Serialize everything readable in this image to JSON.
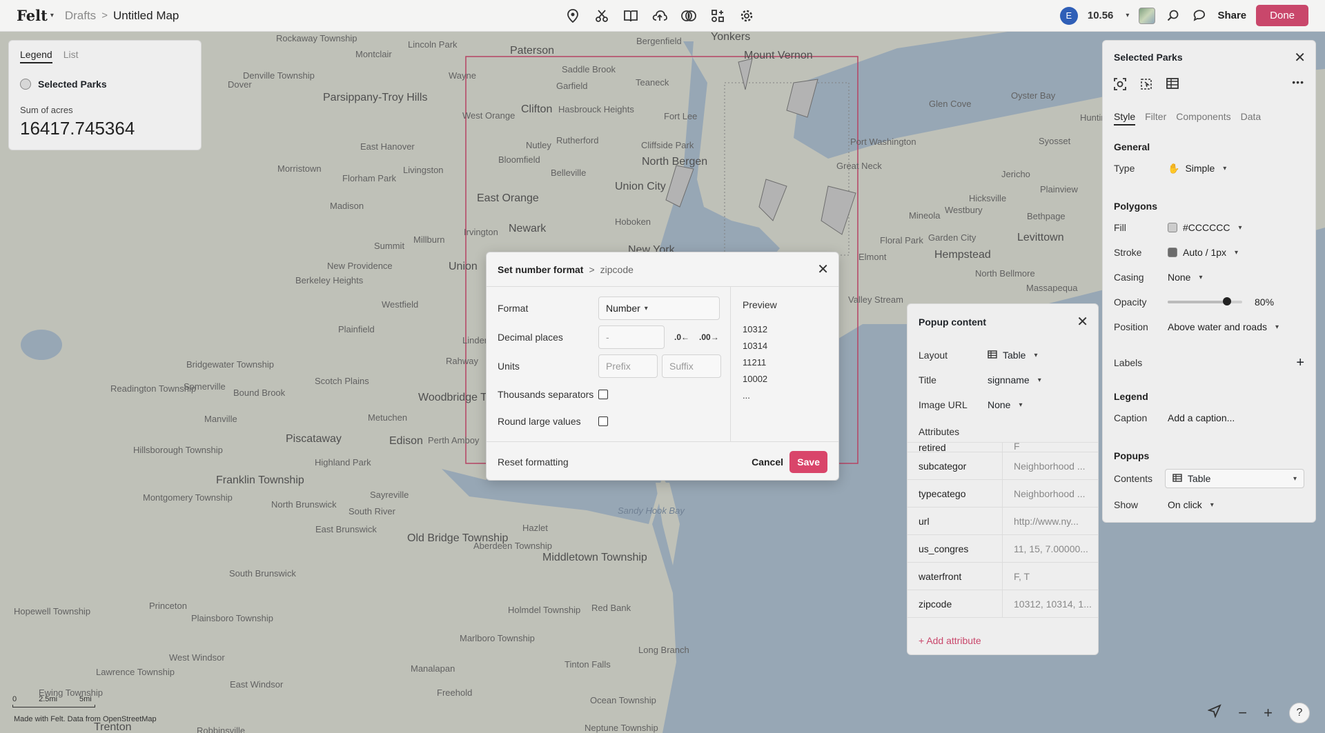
{
  "topbar": {
    "logo": "Felt",
    "breadcrumb_parent": "Drafts",
    "breadcrumb_sep": ">",
    "map_title": "Untitled Map",
    "avatar_initial": "E",
    "zoom_level": "10.56",
    "share_label": "Share",
    "done_label": "Done",
    "tools": [
      "pin-icon",
      "scissors-icon",
      "book-icon",
      "upload-icon",
      "blend-icon",
      "elements-icon",
      "gear-icon"
    ]
  },
  "legend": {
    "tabs": [
      "Legend",
      "List"
    ],
    "layer_name": "Selected Parks",
    "stat_label": "Sum of acres",
    "stat_value": "16417.745364"
  },
  "dialog": {
    "title": "Set number format",
    "sep": ">",
    "field": "zipcode",
    "format_label": "Format",
    "format_value": "Number",
    "decimal_label": "Decimal places",
    "decimal_placeholder": "-",
    "units_label": "Units",
    "prefix_placeholder": "Prefix",
    "suffix_placeholder": "Suffix",
    "thousands_label": "Thousands separators",
    "round_label": "Round large values",
    "preview_label": "Preview",
    "preview_values": [
      "10312",
      "10314",
      "11211",
      "10002",
      "..."
    ],
    "reset_label": "Reset formatting",
    "cancel_label": "Cancel",
    "save_label": "Save"
  },
  "popup_panel": {
    "title": "Popup content",
    "layout_label": "Layout",
    "layout_value": "Table",
    "title_label": "Title",
    "title_value": "signname",
    "image_label": "Image URL",
    "image_value": "None",
    "attributes_label": "Attributes",
    "attributes": [
      {
        "key": "retired",
        "value": "F"
      },
      {
        "key": "subcategor",
        "value": "Neighborhood ..."
      },
      {
        "key": "typecatego",
        "value": "Neighborhood ..."
      },
      {
        "key": "url",
        "value": "http://www.ny..."
      },
      {
        "key": "us_congres",
        "value": "11, 15, 7.00000..."
      },
      {
        "key": "waterfront",
        "value": "F, T"
      },
      {
        "key": "zipcode",
        "value": "10312, 10314, 1..."
      }
    ],
    "add_attribute": "Add attribute"
  },
  "right_panel": {
    "title": "Selected Parks",
    "tabs": [
      "Style",
      "Filter",
      "Components",
      "Data"
    ],
    "general_h": "General",
    "type_label": "Type",
    "type_value": "Simple",
    "polygons_h": "Polygons",
    "fill_label": "Fill",
    "fill_value": "#CCCCCC",
    "fill_color": "#CCCCCC",
    "stroke_label": "Stroke",
    "stroke_value": "Auto / 1px",
    "stroke_color": "#6b6b6b",
    "casing_label": "Casing",
    "casing_value": "None",
    "opacity_label": "Opacity",
    "opacity_value": "80%",
    "opacity_fraction": 0.8,
    "position_label": "Position",
    "position_value": "Above water and roads",
    "labels_h": "Labels",
    "legend_h": "Legend",
    "caption_label": "Caption",
    "caption_placeholder": "Add a caption...",
    "popups_h": "Popups",
    "contents_label": "Contents",
    "contents_value": "Table",
    "show_label": "Show",
    "show_value": "On click"
  },
  "map": {
    "labels": [
      "Paterson",
      "Yonkers",
      "Mount Vernon",
      "Bergenfield",
      "Teaneck",
      "Fort Lee",
      "Clifton",
      "Newark",
      "East Orange",
      "Union City",
      "Hoboken",
      "North Bergen",
      "New York",
      "Garden City",
      "Hempstead",
      "Levittown",
      "Edison",
      "Woodbridge Township",
      "Perth Amboy",
      "Franklin Township",
      "Piscataway",
      "Plainfield",
      "Westfield",
      "Union",
      "Old Bridge Township",
      "Middletown Township",
      "Red Bank",
      "Long Branch",
      "Hazlet",
      "Sandy Hook Bay",
      "Princeton",
      "Trenton",
      "Freehold",
      "Ocean Township",
      "Neptune Township",
      "Montclair",
      "Bloomfield",
      "Irvington",
      "Livingston",
      "Morristown",
      "Madison",
      "Summit",
      "Millburn",
      "Linden",
      "Rahway",
      "Metuchen",
      "Sayreville",
      "South River",
      "East Brunswick",
      "North Brunswick",
      "Glen Cove",
      "Oyster Bay",
      "Hicksville",
      "Jericho",
      "Mineola",
      "Westbury",
      "Great Neck",
      "Port Washington",
      "Valley Stream",
      "Floral Park",
      "Elmont",
      "North Bellmore",
      "Massapequa",
      "Bethpage",
      "Plainview",
      "Syosset",
      "Huntington",
      "Denville Township",
      "Parsippany-Troy Hills",
      "Dover",
      "Rockaway Township",
      "Wayne",
      "Lincoln Park",
      "Saddle Brook",
      "Garfield",
      "Hasbrouck Heights",
      "Rutherford",
      "Nutley",
      "Belleville",
      "Cliffside Park",
      "West Orange",
      "East Hanover",
      "Florham Park",
      "New Providence",
      "Berkeley Heights",
      "Bridgewater Township",
      "Somerville",
      "Bound Brook",
      "Scotch Plains",
      "Manville",
      "Hillsborough Township",
      "Readington Township",
      "Highland Park",
      "Montgomery Township",
      "South Brunswick",
      "Plainsboro Township",
      "West Windsor",
      "Lawrence Township",
      "Hopewell Township",
      "Ewing Township",
      "East Windsor",
      "Robbinsville",
      "Manalapan",
      "Marlboro Township",
      "Holmdel Township",
      "Aberdeen Township",
      "Tinton Falls"
    ],
    "scale": [
      "0",
      "2.5mi",
      "5mi"
    ],
    "attribution": "Made with Felt. Data from OpenStreetMap"
  }
}
